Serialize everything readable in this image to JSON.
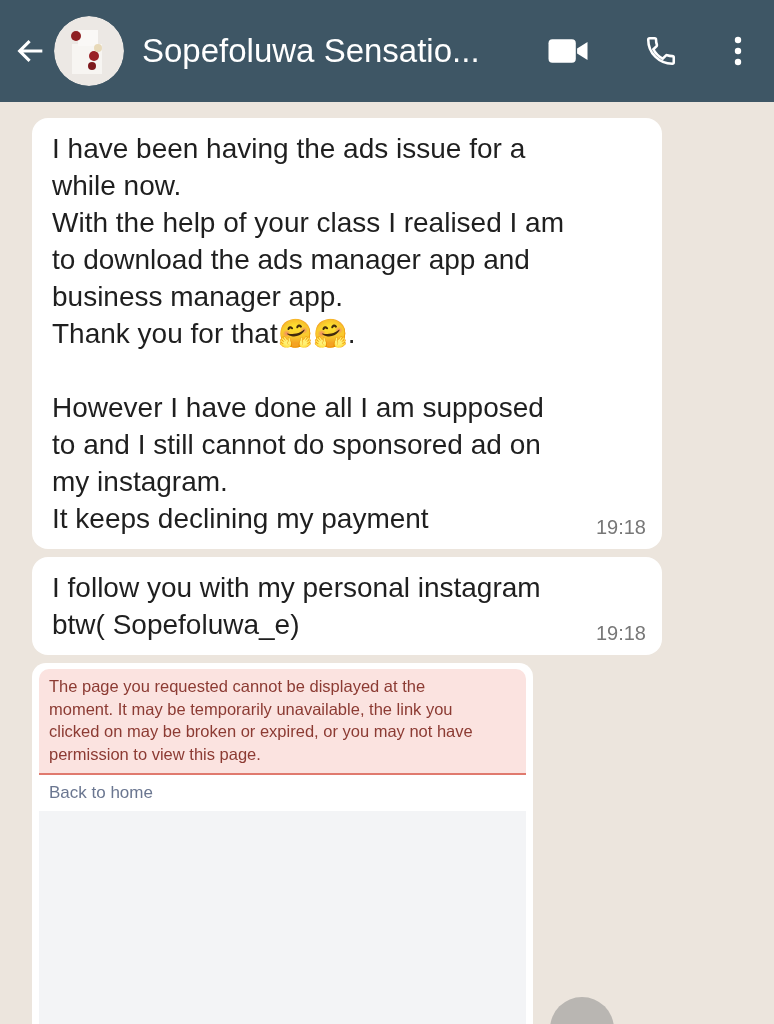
{
  "header": {
    "contact_name": "Sopefoluwa Sensatio..."
  },
  "messages": [
    {
      "kind": "text",
      "text": "I have been having the ads issue for a while now.\nWith the help of your class I realised I am to download the ads manager app and business manager app.\nThank you for that🤗🤗.\n\nHowever I have done all I am supposed to and I still cannot do sponsored ad on my instagram.\nIt keeps declining my payment",
      "time": "19:18"
    },
    {
      "kind": "text",
      "text": "I follow you with my personal instagram btw( Sopefoluwa_e)",
      "time": "19:18"
    },
    {
      "kind": "page",
      "error": "The page you requested cannot be displayed at the moment. It may be temporarily unavailable, the link you clicked on may be broken or expired, or you may not have permission to view this page.",
      "link": "Back to home"
    }
  ]
}
